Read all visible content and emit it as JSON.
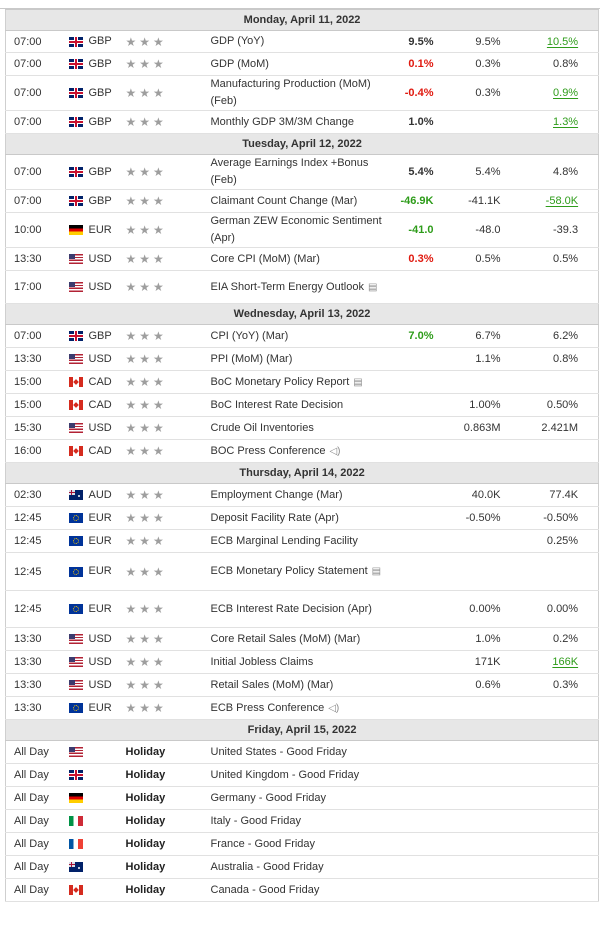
{
  "days": [
    {
      "label": "Monday, April 11, 2022",
      "events": [
        {
          "time": "07:00",
          "currency": "GBP",
          "flag": "gbp",
          "event": "GDP (YoY)",
          "actual": "9.5%",
          "actual_color": "black",
          "forecast": "9.5%",
          "previous": "10.5%",
          "previous_color": "green",
          "previous_underline": true
        },
        {
          "time": "07:00",
          "currency": "GBP",
          "flag": "gbp",
          "event": "GDP (MoM)",
          "actual": "0.1%",
          "actual_color": "red",
          "forecast": "0.3%",
          "previous": "0.8%",
          "previous_color": "black",
          "previous_underline": false
        },
        {
          "time": "07:00",
          "currency": "GBP",
          "flag": "gbp",
          "event": "Manufacturing Production (MoM) (Feb)",
          "actual": "-0.4%",
          "actual_color": "red",
          "forecast": "0.3%",
          "previous": "0.9%",
          "previous_color": "green",
          "previous_underline": true
        },
        {
          "time": "07:00",
          "currency": "GBP",
          "flag": "gbp",
          "event": "Monthly GDP 3M/3M Change",
          "actual": "1.0%",
          "actual_color": "black",
          "forecast": "",
          "previous": "1.3%",
          "previous_color": "green",
          "previous_underline": true
        }
      ]
    },
    {
      "label": "Tuesday, April 12, 2022",
      "events": [
        {
          "time": "07:00",
          "currency": "GBP",
          "flag": "gbp",
          "event": "Average Earnings Index +Bonus (Feb)",
          "actual": "5.4%",
          "actual_color": "black",
          "forecast": "5.4%",
          "previous": "4.8%",
          "previous_color": "black",
          "previous_underline": false
        },
        {
          "time": "07:00",
          "currency": "GBP",
          "flag": "gbp",
          "event": "Claimant Count Change (Mar)",
          "actual": "-46.9K",
          "actual_color": "green",
          "forecast": "-41.1K",
          "previous": "-58.0K",
          "previous_color": "green",
          "previous_underline": true
        },
        {
          "time": "10:00",
          "currency": "EUR",
          "flag": "de",
          "event": "German ZEW Economic Sentiment (Apr)",
          "actual": "-41.0",
          "actual_color": "green",
          "forecast": "-48.0",
          "previous": "-39.3",
          "previous_color": "black",
          "previous_underline": false
        },
        {
          "time": "13:30",
          "currency": "USD",
          "flag": "usd",
          "event": "Core CPI (MoM) (Mar)",
          "actual": "0.3%",
          "actual_color": "red",
          "forecast": "0.5%",
          "previous": "0.5%",
          "previous_color": "black",
          "previous_underline": false
        },
        {
          "time": "17:00",
          "currency": "USD",
          "flag": "usd",
          "event": "EIA Short-Term Energy Outlook",
          "icon": "document-icon",
          "actual": "",
          "actual_color": "black",
          "forecast": "",
          "previous": "",
          "previous_color": "black",
          "previous_underline": false
        }
      ]
    },
    {
      "label": "Wednesday, April 13, 2022",
      "events": [
        {
          "time": "07:00",
          "currency": "GBP",
          "flag": "gbp",
          "event": "CPI (YoY) (Mar)",
          "actual": "7.0%",
          "actual_color": "green",
          "forecast": "6.7%",
          "previous": "6.2%",
          "previous_color": "black",
          "previous_underline": false
        },
        {
          "time": "13:30",
          "currency": "USD",
          "flag": "usd",
          "event": "PPI (MoM) (Mar)",
          "actual": "",
          "actual_color": "black",
          "forecast": "1.1%",
          "previous": "0.8%",
          "previous_color": "black",
          "previous_underline": false
        },
        {
          "time": "15:00",
          "currency": "CAD",
          "flag": "cad",
          "event": "BoC Monetary Policy Report",
          "icon": "document-icon",
          "actual": "",
          "actual_color": "black",
          "forecast": "",
          "previous": "",
          "previous_color": "black",
          "previous_underline": false
        },
        {
          "time": "15:00",
          "currency": "CAD",
          "flag": "cad",
          "event": "BoC Interest Rate Decision",
          "actual": "",
          "actual_color": "black",
          "forecast": "1.00%",
          "previous": "0.50%",
          "previous_color": "black",
          "previous_underline": false
        },
        {
          "time": "15:30",
          "currency": "USD",
          "flag": "usd",
          "event": "Crude Oil Inventories",
          "actual": "",
          "actual_color": "black",
          "forecast": "0.863M",
          "previous": "2.421M",
          "previous_color": "black",
          "previous_underline": false
        },
        {
          "time": "16:00",
          "currency": "CAD",
          "flag": "cad",
          "event": "BOC Press Conference",
          "icon": "speaker-icon",
          "actual": "",
          "actual_color": "black",
          "forecast": "",
          "previous": "",
          "previous_color": "black",
          "previous_underline": false
        }
      ]
    },
    {
      "label": "Thursday, April 14, 2022",
      "events": [
        {
          "time": "02:30",
          "currency": "AUD",
          "flag": "aud",
          "event": "Employment Change (Mar)",
          "actual": "",
          "actual_color": "black",
          "forecast": "40.0K",
          "previous": "77.4K",
          "previous_color": "black",
          "previous_underline": false
        },
        {
          "time": "12:45",
          "currency": "EUR",
          "flag": "eur",
          "event": "Deposit Facility Rate (Apr)",
          "actual": "",
          "actual_color": "black",
          "forecast": "-0.50%",
          "previous": "-0.50%",
          "previous_color": "black",
          "previous_underline": false
        },
        {
          "time": "12:45",
          "currency": "EUR",
          "flag": "eur",
          "event": "ECB Marginal Lending Facility",
          "actual": "",
          "actual_color": "black",
          "forecast": "",
          "previous": "0.25%",
          "previous_color": "black",
          "previous_underline": false
        },
        {
          "time": "12:45",
          "currency": "EUR",
          "flag": "eur",
          "event": "ECB Monetary Policy Statement",
          "icon": "document-icon",
          "actual": "",
          "actual_color": "black",
          "forecast": "",
          "previous": "",
          "previous_color": "black",
          "previous_underline": false
        },
        {
          "time": "12:45",
          "currency": "EUR",
          "flag": "eur",
          "event": "ECB Interest Rate Decision (Apr)",
          "actual": "",
          "actual_color": "black",
          "forecast": "0.00%",
          "previous": "0.00%",
          "previous_color": "black",
          "previous_underline": false
        },
        {
          "time": "13:30",
          "currency": "USD",
          "flag": "usd",
          "event": "Core Retail Sales (MoM) (Mar)",
          "actual": "",
          "actual_color": "black",
          "forecast": "1.0%",
          "previous": "0.2%",
          "previous_color": "black",
          "previous_underline": false
        },
        {
          "time": "13:30",
          "currency": "USD",
          "flag": "usd",
          "event": "Initial Jobless Claims",
          "actual": "",
          "actual_color": "black",
          "forecast": "171K",
          "previous": "166K",
          "previous_color": "green",
          "previous_underline": true
        },
        {
          "time": "13:30",
          "currency": "USD",
          "flag": "usd",
          "event": "Retail Sales (MoM) (Mar)",
          "actual": "",
          "actual_color": "black",
          "forecast": "0.6%",
          "previous": "0.3%",
          "previous_color": "black",
          "previous_underline": false
        },
        {
          "time": "13:30",
          "currency": "EUR",
          "flag": "eur",
          "event": "ECB Press Conference",
          "icon": "speaker-icon",
          "actual": "",
          "actual_color": "black",
          "forecast": "",
          "previous": "",
          "previous_color": "black",
          "previous_underline": false
        }
      ]
    },
    {
      "label": "Friday, April 15, 2022",
      "events": [
        {
          "time": "All Day",
          "currency": "",
          "flag": "usd",
          "holiday": "Holiday",
          "event": "United States - Good Friday"
        },
        {
          "time": "All Day",
          "currency": "",
          "flag": "gbp",
          "holiday": "Holiday",
          "event": "United Kingdom - Good Friday"
        },
        {
          "time": "All Day",
          "currency": "",
          "flag": "de",
          "holiday": "Holiday",
          "event": "Germany - Good Friday"
        },
        {
          "time": "All Day",
          "currency": "",
          "flag": "ita",
          "holiday": "Holiday",
          "event": "Italy - Good Friday"
        },
        {
          "time": "All Day",
          "currency": "",
          "flag": "fra",
          "holiday": "Holiday",
          "event": "France - Good Friday"
        },
        {
          "time": "All Day",
          "currency": "",
          "flag": "aud",
          "holiday": "Holiday",
          "event": "Australia - Good Friday"
        },
        {
          "time": "All Day",
          "currency": "",
          "flag": "cad",
          "holiday": "Holiday",
          "event": "Canada - Good Friday"
        }
      ]
    }
  ],
  "importance_glyph": "★★★",
  "colors": {
    "red": "#e0190f",
    "green": "#2e9c1a",
    "header_bg": "#e7e7e7",
    "star": "#9e9e9e"
  }
}
